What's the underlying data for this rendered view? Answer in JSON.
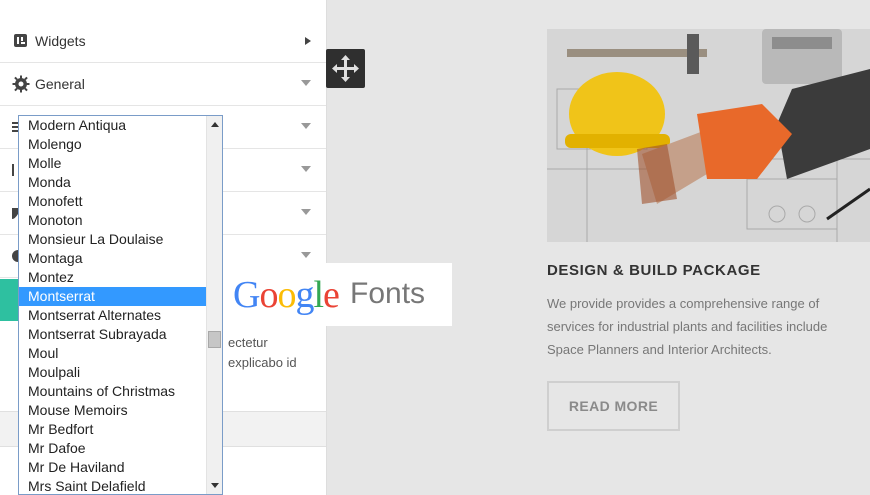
{
  "panel": {
    "rows": [
      {
        "label": "Widgets",
        "icon": "widgets-icon",
        "arrow": "right"
      },
      {
        "label": "General",
        "icon": "gear-icon",
        "arrow": "down"
      },
      {
        "label": "",
        "icon": "list-icon",
        "arrow": "down"
      },
      {
        "label": "",
        "icon": "columns-icon",
        "arrow": "down"
      },
      {
        "label": "",
        "icon": "shield-icon",
        "arrow": "down"
      },
      {
        "label": "",
        "icon": "circle-icon",
        "arrow": "down"
      }
    ],
    "partial_text_1": "ectetur",
    "partial_text_2": "explicabo id"
  },
  "font_dropdown": {
    "items": [
      "Modern Antiqua",
      "Molengo",
      "Molle",
      "Monda",
      "Monofett",
      "Monoton",
      "Monsieur La Doulaise",
      "Montaga",
      "Montez",
      "Montserrat",
      "Montserrat Alternates",
      "Montserrat Subrayada",
      "Moul",
      "Moulpali",
      "Mountains of Christmas",
      "Mouse Memoirs",
      "Mr Bedfort",
      "Mr Dafoe",
      "Mr De Haviland",
      "Mrs Saint Delafield"
    ],
    "selected": "Montserrat"
  },
  "badge": {
    "google_letters": [
      {
        "ch": "G",
        "color": "#4285f4"
      },
      {
        "ch": "o",
        "color": "#ea4335"
      },
      {
        "ch": "o",
        "color": "#fbbc05"
      },
      {
        "ch": "g",
        "color": "#4285f4"
      },
      {
        "ch": "l",
        "color": "#34a853"
      },
      {
        "ch": "e",
        "color": "#ea4335"
      }
    ],
    "fonts": "Fonts"
  },
  "card": {
    "title": "DESIGN & BUILD PACKAGE",
    "lines": [
      "We provide  provides a comprehensive range of",
      "services for industrial plants and facilities include",
      "Space Planners and Interior Architects."
    ],
    "button": "READ MORE"
  },
  "colors": {
    "accent_green": "#2ec0a0",
    "selection_blue": "#3399ff"
  }
}
